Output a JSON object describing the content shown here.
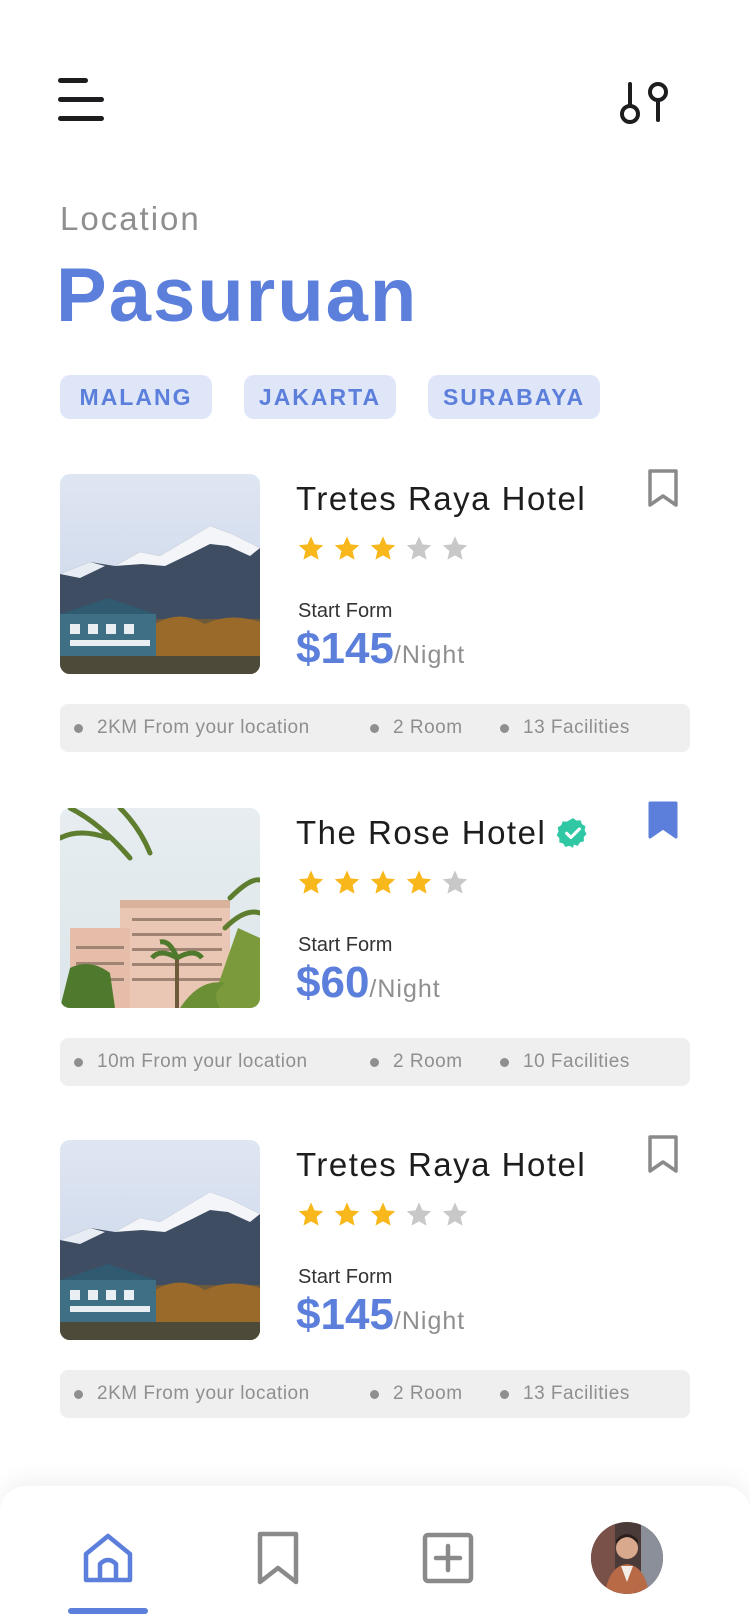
{
  "header": {
    "menu_icon": "hamburger-menu-icon",
    "filter_icon": "filter-sliders-icon"
  },
  "location": {
    "label": "Location",
    "city": "Pasuruan"
  },
  "chips": [
    "MALANG",
    "JAKARTA",
    "SURABAYA"
  ],
  "hotels": [
    {
      "name": "Tretes Raya Hotel",
      "verified": false,
      "rating": 3,
      "start_from_label": "Start Form",
      "price": "$145",
      "unit": "/Night",
      "bookmarked": false,
      "distance": "2KM From  your location",
      "rooms": "2 Room",
      "facilities": "13 Facilities"
    },
    {
      "name": "The Rose Hotel",
      "verified": true,
      "rating": 4,
      "start_from_label": "Start Form",
      "price": "$60",
      "unit": "/Night",
      "bookmarked": true,
      "distance": "10m From  your location",
      "rooms": "2 Room",
      "facilities": "10 Facilities"
    },
    {
      "name": "Tretes Raya Hotel",
      "verified": false,
      "rating": 3,
      "start_from_label": "Start Form",
      "price": "$145",
      "unit": "/Night",
      "bookmarked": false,
      "distance": "2KM From  your location",
      "rooms": "2 Room",
      "facilities": "13 Facilities"
    }
  ],
  "bottom_nav": {
    "items": [
      "home-icon",
      "bookmark-icon",
      "add-icon",
      "profile-avatar"
    ],
    "active": "home-icon"
  },
  "colors": {
    "accent": "#5b7fdb",
    "chip_bg": "#dfe6f8",
    "star_on": "#f8b81c",
    "star_off": "#c8c8c8",
    "verified": "#2fc7a4",
    "info_bg": "#efefef"
  }
}
